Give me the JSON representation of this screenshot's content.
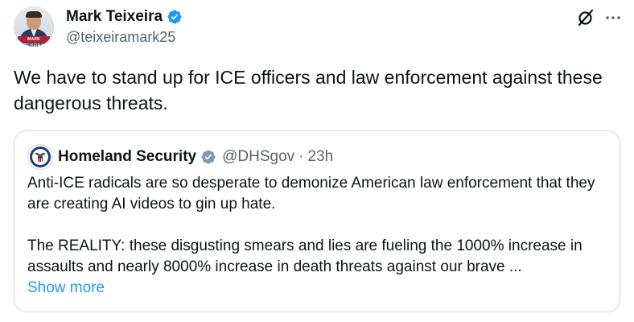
{
  "author": {
    "name": "Mark Teixeira",
    "handle": "@teixeiramark25",
    "avatar_sign": "MARK TEIXEIRA",
    "verified_color": "#1d9bf0"
  },
  "tweet": {
    "text": "We have to stand up for ICE officers and law enforcement against these dangerous threats."
  },
  "quoted": {
    "name": "Homeland Security",
    "handle": "@DHSgov",
    "separator": "·",
    "time": "23h",
    "badge_color": "#829aab",
    "paragraph1": "Anti-ICE radicals are so desperate to demonize American law enforcement that they are creating AI videos to gin up hate.",
    "paragraph2": "The REALITY: these disgusting smears and lies are fueling the 1000% increase in assaults and nearly 8000% increase in death threats against our brave ...",
    "show_more": "Show more"
  },
  "icons": {
    "grok": "grok-icon",
    "more": "more-icon"
  },
  "colors": {
    "link": "#1d9bf0",
    "secondary_text": "#536471",
    "border": "#cfd9de"
  }
}
